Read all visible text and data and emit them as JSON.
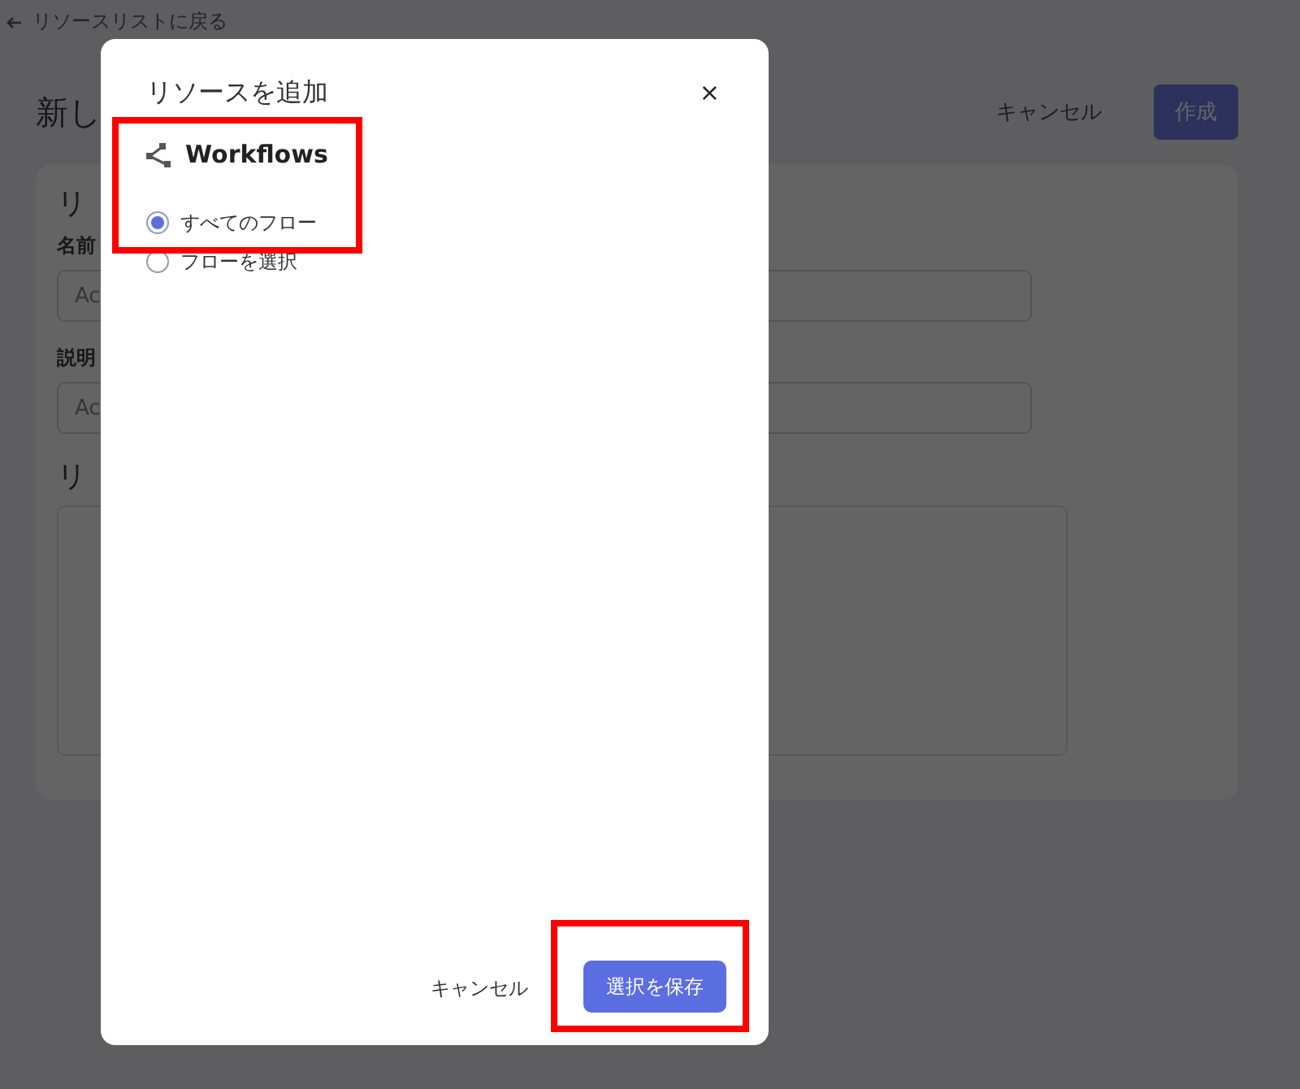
{
  "back_link": {
    "label": "リソースリストに戻る"
  },
  "page": {
    "title": "新し",
    "actions": [
      {
        "label": "キャンセル",
        "kind": "text"
      },
      {
        "label": "作成",
        "kind": "primary"
      }
    ],
    "card": {
      "heading": "リ",
      "fields": [
        {
          "label": "名前",
          "placeholder": "Ac"
        },
        {
          "label": "説明",
          "placeholder": "Ac"
        }
      ],
      "section_heading": "リ"
    }
  },
  "dialog": {
    "title": "リソースを追加",
    "close": "×",
    "provider": {
      "name": "Workflows",
      "highlighted": true
    },
    "options": [
      {
        "label": "すべてのフロー",
        "selected": true
      },
      {
        "label": "フローを選択",
        "selected": false
      }
    ],
    "buttons": [
      {
        "label": "キャンセル",
        "kind": "text",
        "highlighted": false
      },
      {
        "label": "選択を保存",
        "kind": "primary",
        "highlighted": true
      }
    ]
  }
}
